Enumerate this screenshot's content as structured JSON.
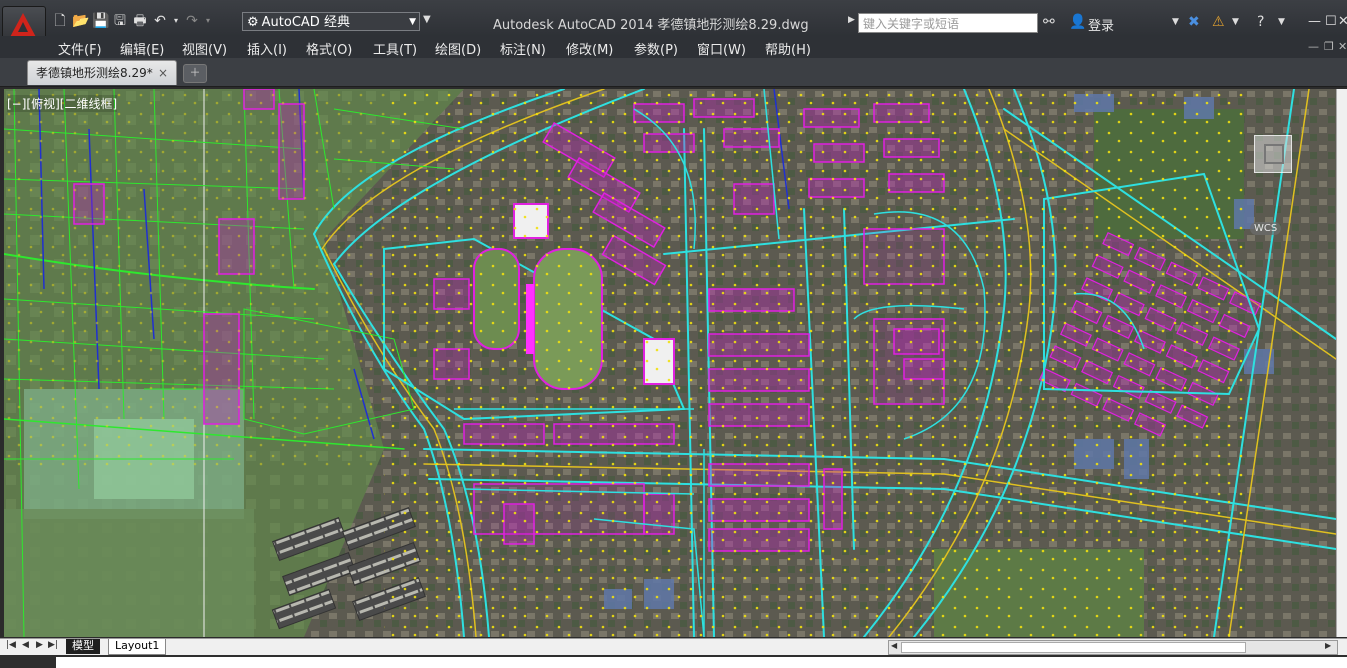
{
  "app": {
    "title": "Autodesk AutoCAD 2014    孝德镇地形测绘8.29.dwg",
    "workspace": "AutoCAD 经典"
  },
  "search": {
    "placeholder": "键入关键字或短语"
  },
  "account": {
    "login_label": "登录"
  },
  "menu": [
    "文件(F)",
    "编辑(E)",
    "视图(V)",
    "插入(I)",
    "格式(O)",
    "工具(T)",
    "绘图(D)",
    "标注(N)",
    "修改(M)",
    "参数(P)",
    "窗口(W)",
    "帮助(H)"
  ],
  "document_tab": {
    "label": "孝德镇地形测绘8.29*",
    "close": "×"
  },
  "viewport": {
    "label": "[−][俯视][二维线框]",
    "wcs_label": "WCS"
  },
  "layout_tabs": [
    "模型",
    "Layout1"
  ],
  "colors": {
    "boundary": "#2ee82e",
    "building": "#e020e0",
    "road": "#2ee0e0",
    "road_axis": "#e0c020",
    "dot": "#f0e010",
    "parcel": "#2030d0"
  },
  "icons": {
    "app_menu": "autocad-logo-icon",
    "new": "new-file-icon",
    "open": "open-folder-icon",
    "save": "save-icon",
    "save_as": "save-as-icon",
    "plot": "print-icon",
    "undo": "undo-icon",
    "redo": "redo-icon",
    "help": "help-icon"
  }
}
